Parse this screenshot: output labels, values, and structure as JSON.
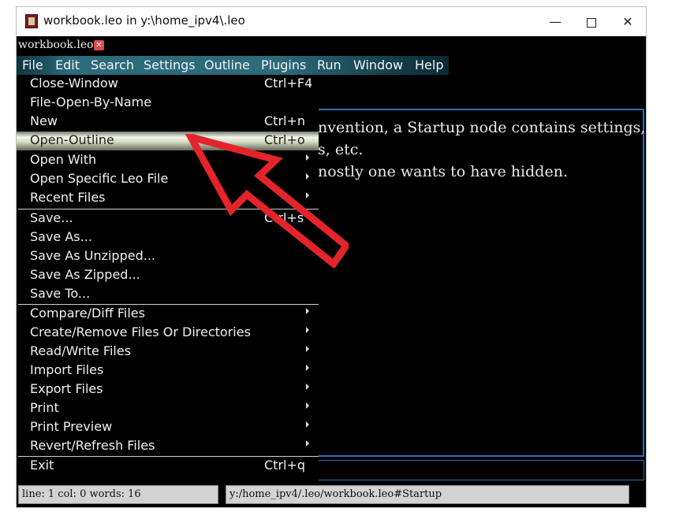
{
  "window": {
    "title": "workbook.leo in y:\\home_ipv4\\.leo",
    "min_glyph": "—",
    "close_glyph": "✕"
  },
  "tab": {
    "label": "workbook.leo",
    "close_glyph": "✕"
  },
  "menubar": {
    "items": [
      "File",
      "Edit",
      "Search",
      "Settings",
      "Outline",
      "Plugins",
      "Run",
      "Window",
      "Help"
    ]
  },
  "file_menu": {
    "items": [
      {
        "label": "Close-Window",
        "shortcut": "Ctrl+F4",
        "submenu": false
      },
      {
        "label": "File-Open-By-Name",
        "shortcut": "",
        "submenu": false
      },
      {
        "label": "New",
        "shortcut": "Ctrl+n",
        "submenu": false
      },
      {
        "label": "Open-Outline",
        "shortcut": "Ctrl+o",
        "submenu": false,
        "highlighted": true
      },
      {
        "label": "Open With",
        "shortcut": "",
        "submenu": true
      },
      {
        "label": "Open Specific Leo File",
        "shortcut": "",
        "submenu": true
      },
      {
        "label": "Recent Files",
        "shortcut": "",
        "submenu": true
      },
      {
        "label": "Save...",
        "shortcut": "Ctrl+s",
        "submenu": false
      },
      {
        "label": "Save As...",
        "shortcut": "",
        "submenu": false
      },
      {
        "label": "Save As Unzipped...",
        "shortcut": "",
        "submenu": false
      },
      {
        "label": "Save As Zipped...",
        "shortcut": "",
        "submenu": false
      },
      {
        "label": "Save To...",
        "shortcut": "",
        "submenu": false
      },
      {
        "label": "Compare/Diff Files",
        "shortcut": "",
        "submenu": true
      },
      {
        "label": "Create/Remove Files Or Directories",
        "shortcut": "",
        "submenu": true
      },
      {
        "label": "Read/Write Files",
        "shortcut": "",
        "submenu": true
      },
      {
        "label": "Import Files",
        "shortcut": "",
        "submenu": true
      },
      {
        "label": "Export Files",
        "shortcut": "",
        "submenu": true
      },
      {
        "label": "Print",
        "shortcut": "",
        "submenu": true
      },
      {
        "label": "Print Preview",
        "shortcut": "",
        "submenu": true
      },
      {
        "label": "Revert/Refresh Files",
        "shortcut": "",
        "submenu": true
      },
      {
        "label": "Exit",
        "shortcut": "Ctrl+q",
        "submenu": false
      }
    ]
  },
  "body": {
    "lines": [
      "nvention, a Startup node contains settings,",
      "s, etc.",
      "nostly one wants to have hidden."
    ]
  },
  "status": {
    "left": "line: 1 col: 0  words: 16",
    "right": "y:/home_ipv4/.leo/workbook.leo#Startup"
  },
  "colors": {
    "menu_bg": "#000000",
    "menubar_accent": "#2d6b7a",
    "pane_border": "#2a6fb8",
    "annotation_arrow": "#e3242b"
  }
}
